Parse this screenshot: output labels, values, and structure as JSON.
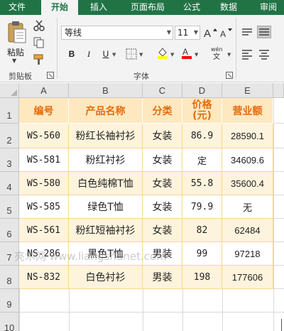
{
  "ribbon": {
    "tabs": [
      "文件",
      "开始",
      "插入",
      "页面布局",
      "公式",
      "数据",
      "审阅"
    ],
    "active_tab": "开始",
    "clipboard": {
      "paste_label": "粘贴",
      "group_label": "剪贴板"
    },
    "font": {
      "font_name": "等线",
      "font_size": "11",
      "group_label": "字体",
      "bold": "B",
      "italic": "I",
      "underline": "U",
      "phonetic_label": "wén"
    }
  },
  "sheet": {
    "columns": [
      "A",
      "B",
      "C",
      "D",
      "E"
    ],
    "rows": [
      "1",
      "2",
      "3",
      "4",
      "5",
      "6",
      "7",
      "8",
      "9",
      "10"
    ],
    "headers": [
      "编号",
      "产品名称",
      "分类",
      "价格\n(元)",
      "营业额"
    ],
    "data": [
      [
        "WS-560",
        "粉红长袖衬衫",
        "女装",
        "86.9",
        "28590.1"
      ],
      [
        "WS-581",
        "粉红衬衫",
        "女装",
        "定",
        "34609.6"
      ],
      [
        "WS-580",
        "白色纯棉T恤",
        "女装",
        "55.8",
        "35600.4"
      ],
      [
        "WS-585",
        "绿色T恤",
        "女装",
        "79.9",
        "无"
      ],
      [
        "WS-561",
        "粉红短袖衬衫",
        "女装",
        "82",
        "62484"
      ],
      [
        "NS-286",
        "黑色T恤",
        "男装",
        "99",
        "97218"
      ],
      [
        "NS-832",
        "白色衬衫",
        "男装",
        "198",
        "177606"
      ]
    ]
  },
  "watermark": "亮术网 www.liangshunet.com"
}
